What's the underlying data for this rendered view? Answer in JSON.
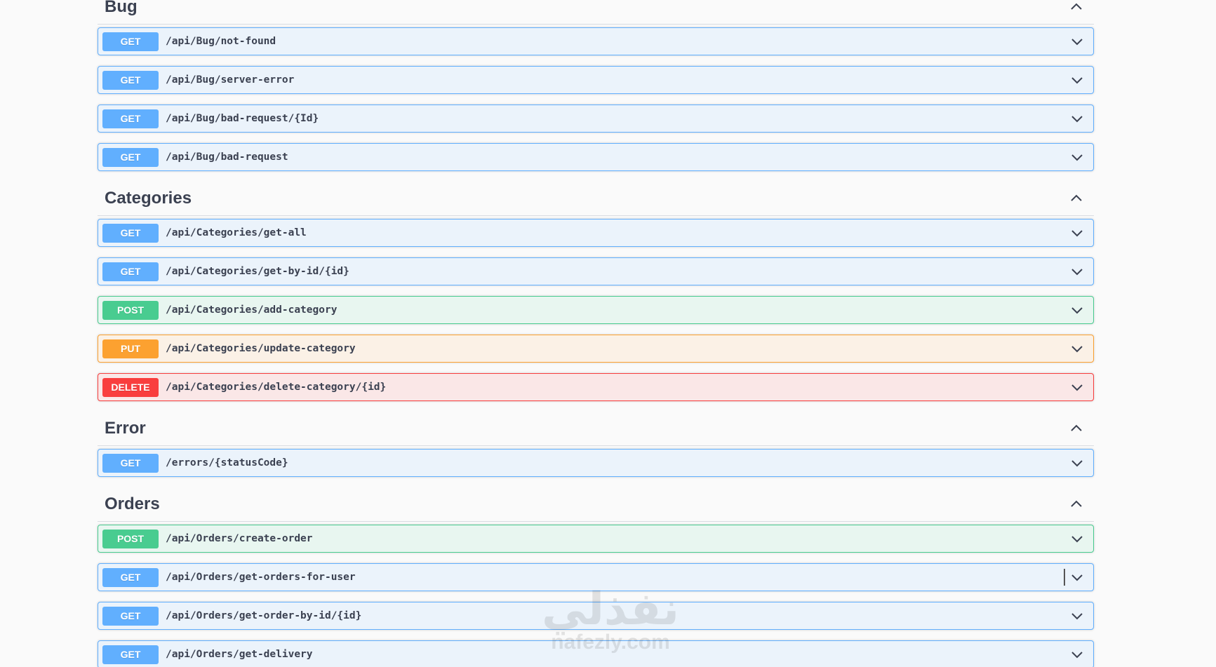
{
  "sections": [
    {
      "title": "Bug",
      "operations": [
        {
          "method": "GET",
          "path": "/api/Bug/not-found"
        },
        {
          "method": "GET",
          "path": "/api/Bug/server-error"
        },
        {
          "method": "GET",
          "path": "/api/Bug/bad-request/{Id}"
        },
        {
          "method": "GET",
          "path": "/api/Bug/bad-request"
        }
      ]
    },
    {
      "title": "Categories",
      "operations": [
        {
          "method": "GET",
          "path": "/api/Categories/get-all"
        },
        {
          "method": "GET",
          "path": "/api/Categories/get-by-id/{id}"
        },
        {
          "method": "POST",
          "path": "/api/Categories/add-category"
        },
        {
          "method": "PUT",
          "path": "/api/Categories/update-category"
        },
        {
          "method": "DELETE",
          "path": "/api/Categories/delete-category/{id}"
        }
      ]
    },
    {
      "title": "Error",
      "operations": [
        {
          "method": "GET",
          "path": "/errors/{statusCode}"
        }
      ]
    },
    {
      "title": "Orders",
      "operations": [
        {
          "method": "POST",
          "path": "/api/Orders/create-order"
        },
        {
          "method": "GET",
          "path": "/api/Orders/get-orders-for-user"
        },
        {
          "method": "GET",
          "path": "/api/Orders/get-order-by-id/{id}"
        },
        {
          "method": "GET",
          "path": "/api/Orders/get-delivery"
        }
      ]
    }
  ],
  "watermark": {
    "arabic": "نفذلي",
    "latin": "nafezly.com"
  },
  "colors": {
    "get": "#61affe",
    "post": "#49cc90",
    "put": "#fca130",
    "delete": "#f93e3e"
  },
  "icons": {
    "section_toggle": "chevron-up-icon",
    "operation_toggle": "chevron-down-icon"
  }
}
